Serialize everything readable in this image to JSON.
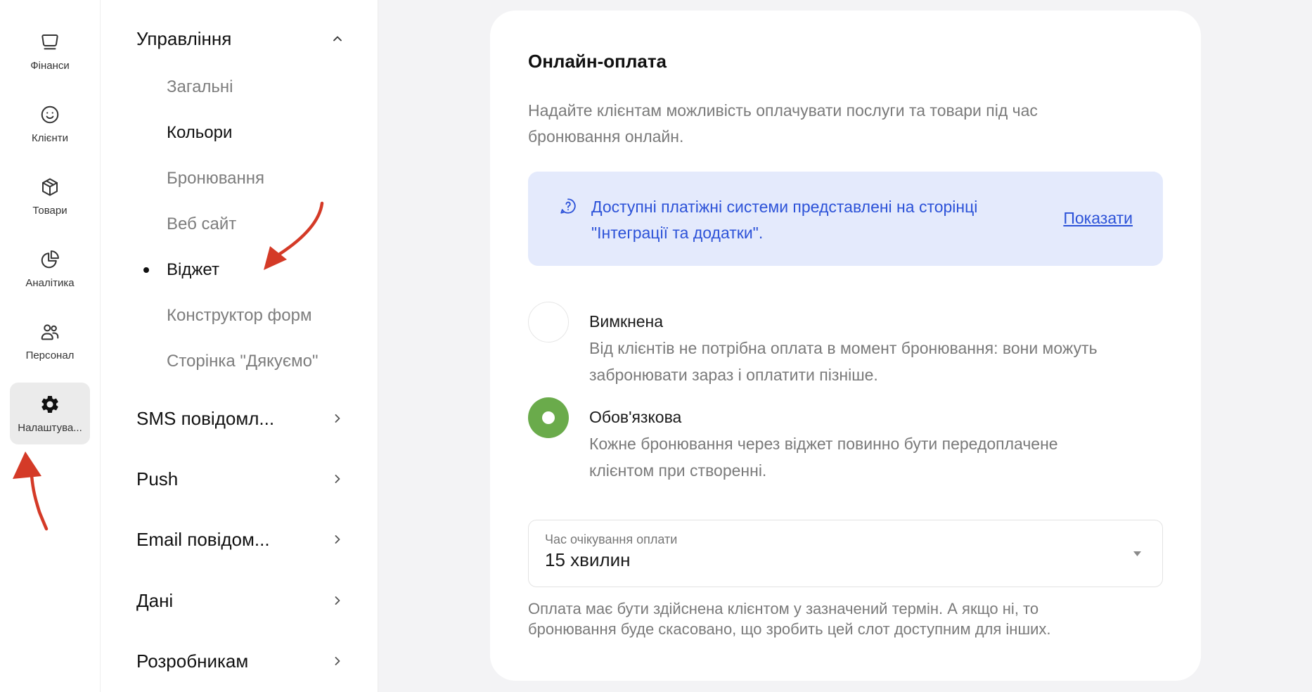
{
  "icon_rail": {
    "items": [
      {
        "label": "Фінанси",
        "icon": "finance-icon",
        "active": false
      },
      {
        "label": "Клієнти",
        "icon": "smile-icon",
        "active": false
      },
      {
        "label": "Товари",
        "icon": "box-icon",
        "active": false
      },
      {
        "label": "Аналітика",
        "icon": "pie-chart-icon",
        "active": false
      },
      {
        "label": "Персонал",
        "icon": "users-icon",
        "active": false
      },
      {
        "label": "Налаштува...",
        "icon": "gear-icon",
        "active": true
      }
    ]
  },
  "settings_menu": {
    "management": {
      "label": "Управління",
      "expanded": true,
      "icon": "chevron-up-icon",
      "items": [
        {
          "label": "Загальні",
          "selected": false
        },
        {
          "label": "Кольори",
          "selected": false
        },
        {
          "label": "Бронювання",
          "selected": false
        },
        {
          "label": "Веб сайт",
          "selected": false
        },
        {
          "label": "Віджет",
          "selected": true
        },
        {
          "label": "Конструктор форм",
          "selected": false
        },
        {
          "label": "Сторінка \"Дякуємо\"",
          "selected": false
        }
      ]
    },
    "sections": [
      {
        "label": "SMS повідомл...",
        "icon": "chevron-right-icon"
      },
      {
        "label": "Push",
        "icon": "chevron-right-icon"
      },
      {
        "label": "Email повідом...",
        "icon": "chevron-right-icon"
      },
      {
        "label": "Дані",
        "icon": "chevron-right-icon"
      },
      {
        "label": "Розробникам",
        "icon": "chevron-right-icon"
      }
    ]
  },
  "online_payment": {
    "title": "Онлайн-оплата",
    "description": [
      "Надайте клієнтам можливість оплачувати послуги та товари під час",
      "бронювання онлайн."
    ],
    "info": {
      "icon": "question-icon",
      "text": [
        "Доступні платіжні системи представлені на сторінці",
        "\"Інтеграції та додатки\"."
      ],
      "link": "Показати"
    },
    "options": [
      {
        "label": "Вимкнена",
        "selected": false,
        "description": [
          "Від клієнтів не потрібна оплата в момент бронювання: вони можуть",
          "забронювати зараз і оплатити пізніше."
        ]
      },
      {
        "label": "Обов'язкова",
        "selected": true,
        "description": [
          "Кожне бронювання через віджет повинно бути передоплачене",
          "клієнтом при створенні."
        ]
      }
    ],
    "timeout_select": {
      "label": "Час очікування оплати",
      "value": "15 хвилин",
      "icon": "dropdown-caret-icon"
    },
    "timeout_hint": [
      "Оплата має бути здійснена клієнтом у зазначений термін. А якщо ні, то",
      "бронювання буде скасовано, що зробить цей слот доступним для інших."
    ]
  },
  "colors": {
    "page_background": "#f3f3f5",
    "accent_green": "#6aab4b",
    "link_blue": "#2c52d8",
    "info_background": "#e4eafc",
    "active_nav_background": "#ebebeb",
    "annotation_red": "#d43a27"
  }
}
